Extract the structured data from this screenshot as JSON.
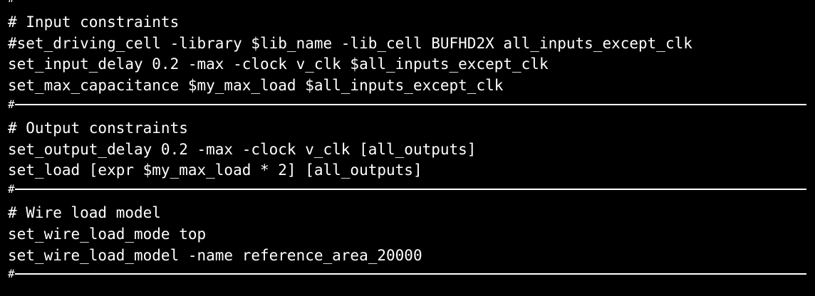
{
  "terminal": {
    "colors": {
      "background": "#000000",
      "text": "#ffffff"
    },
    "separator": "#",
    "lines": {
      "l1": "# Input constraints",
      "l2": "#set_driving_cell -library $lib_name -lib_cell BUFHD2X all_inputs_except_clk",
      "l3": "set_input_delay 0.2 -max -clock v_clk $all_inputs_except_clk",
      "l4": "set_max_capacitance $my_max_load $all_inputs_except_clk",
      "l5": "# Output constraints",
      "l6": "set_output_delay 0.2 -max -clock v_clk [all_outputs]",
      "l7": "set_load [expr $my_max_load * 2] [all_outputs]",
      "l8": "# Wire load model",
      "l9": "set_wire_load_mode top",
      "l10": "set_wire_load_model -name reference_area_20000"
    }
  }
}
